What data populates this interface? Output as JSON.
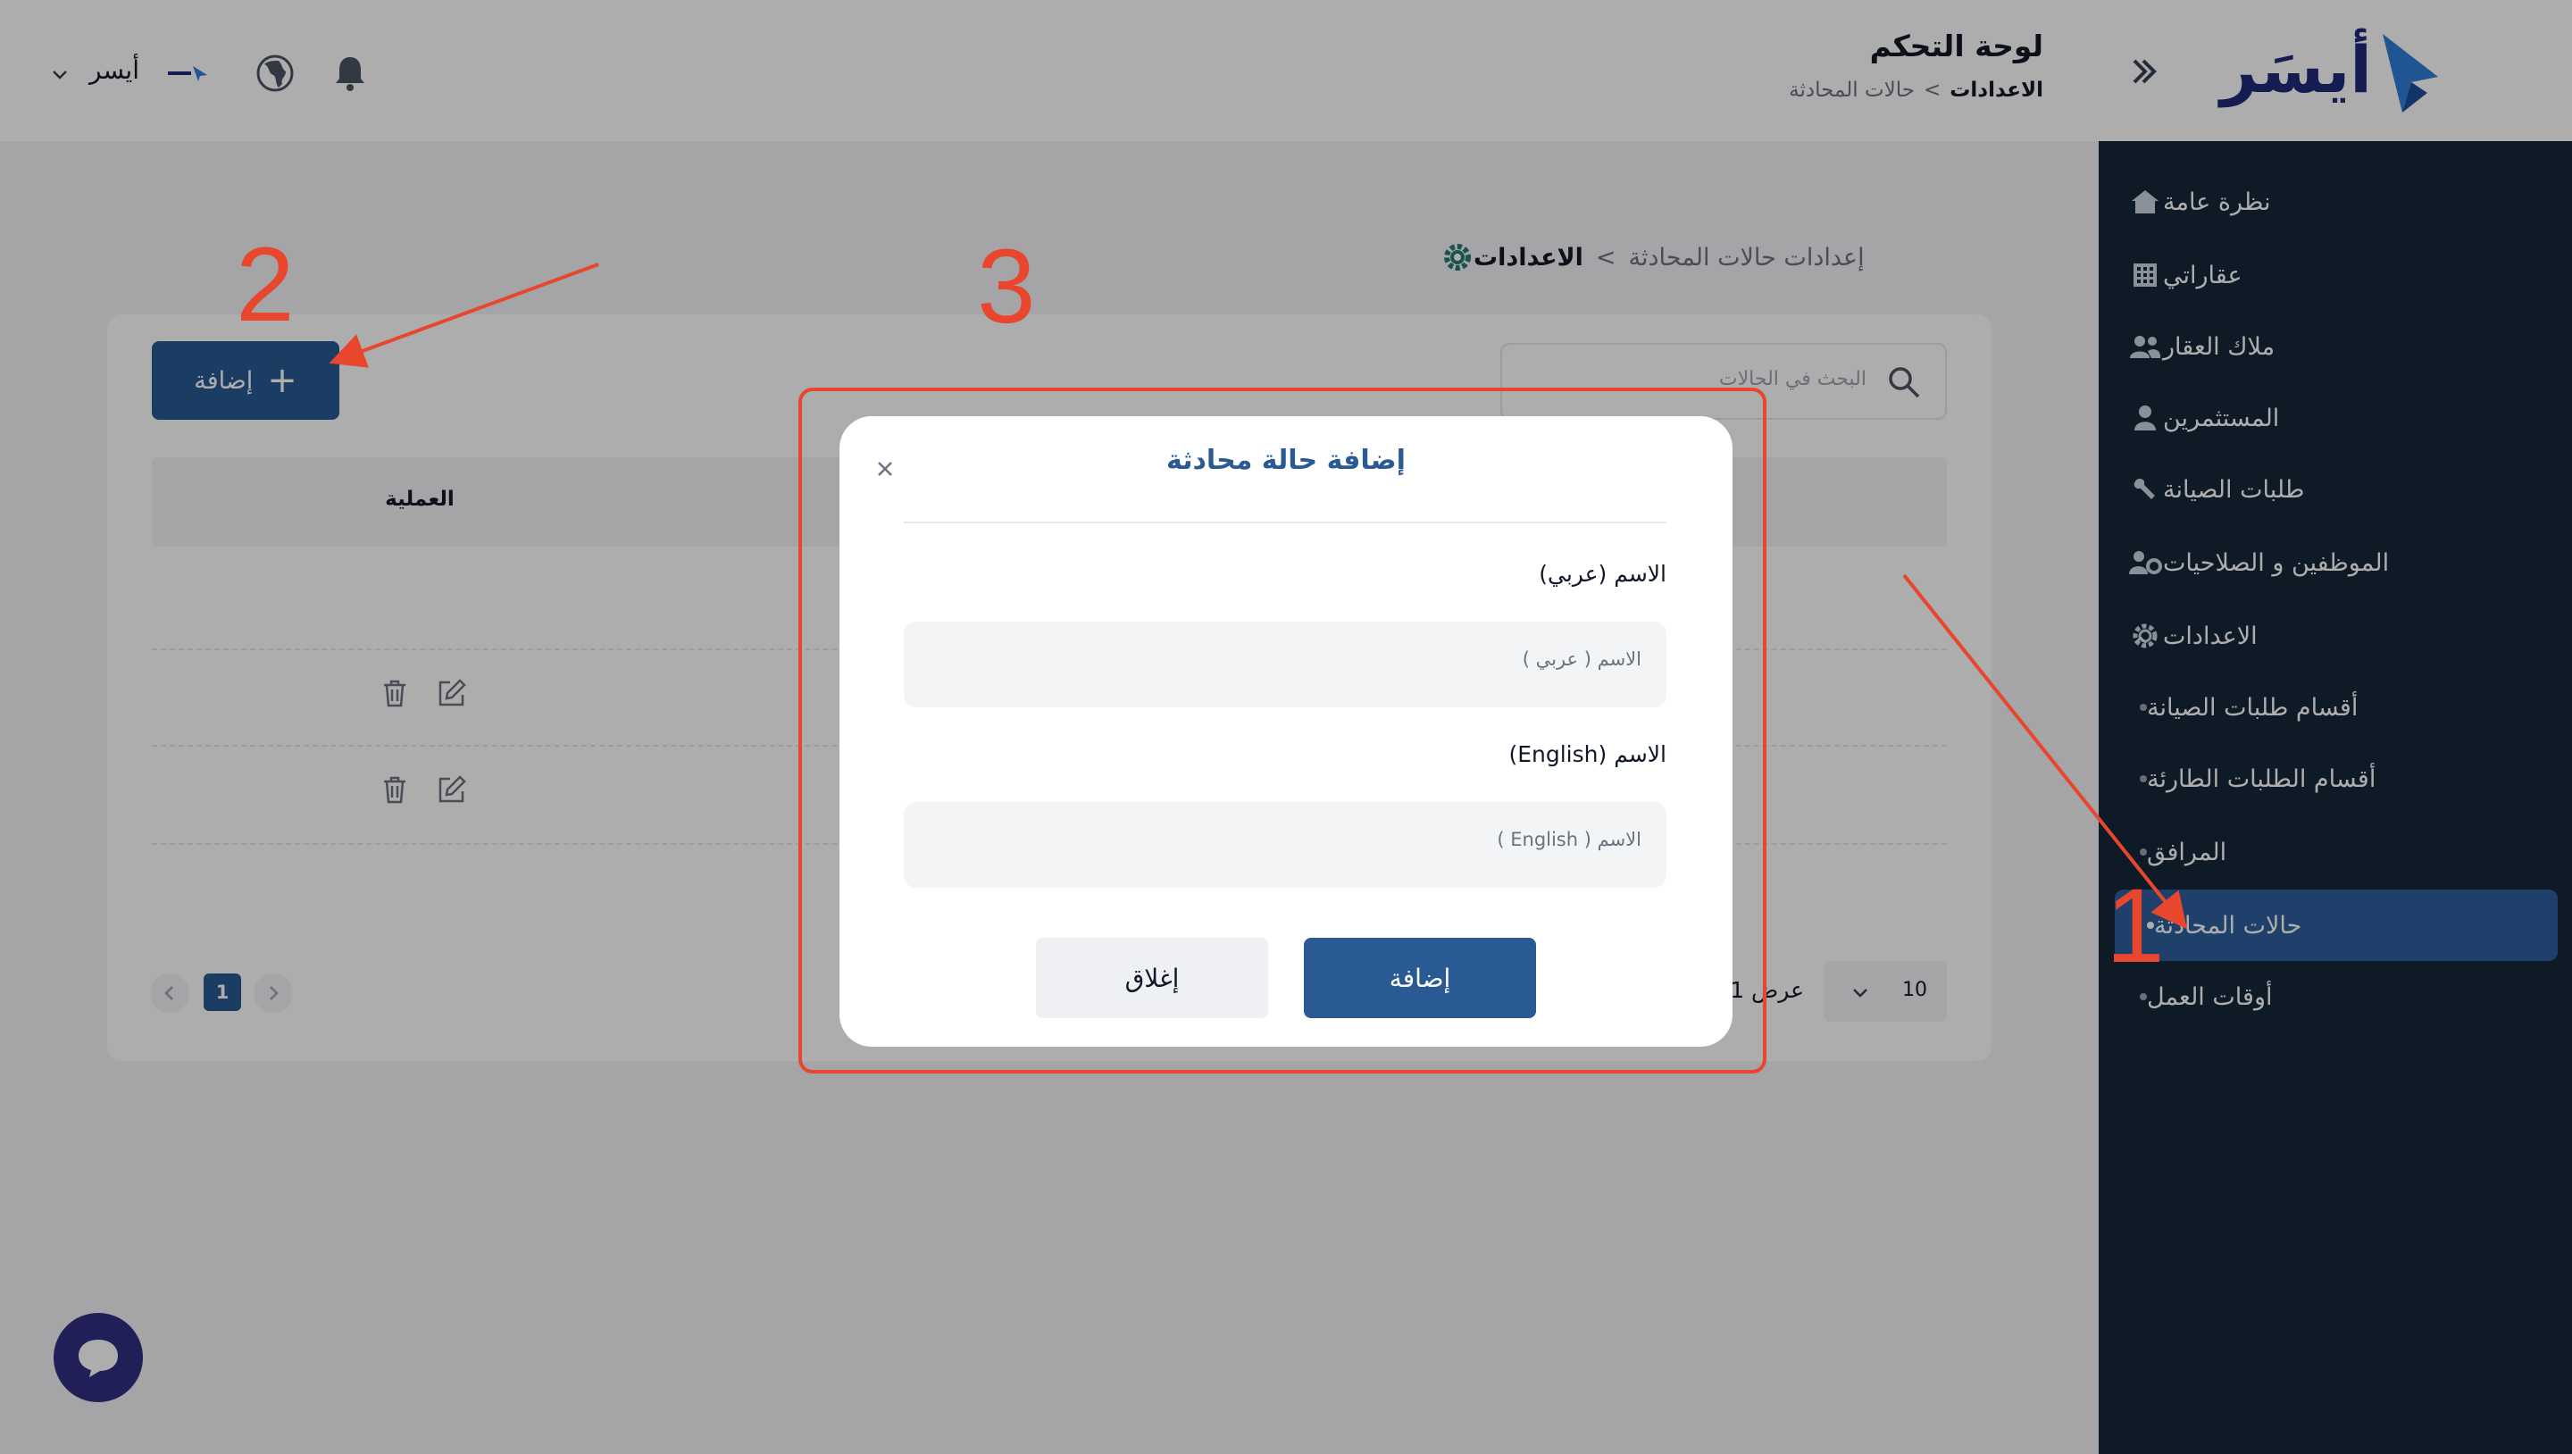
{
  "brand": {
    "name": "أيسَر"
  },
  "header": {
    "title": "لوحة التحكم",
    "breadcrumb": {
      "current": "الاعدادات",
      "separator": ">",
      "last": "حالات المحادثة"
    },
    "user_name": "أيسر"
  },
  "sidebar": {
    "items": [
      {
        "label": "نظرة عامة",
        "icon": "home-icon"
      },
      {
        "label": "عقاراتي",
        "icon": "building-icon"
      },
      {
        "label": "ملاك العقار",
        "icon": "users-icon"
      },
      {
        "label": "المستثمرين",
        "icon": "user-icon"
      },
      {
        "label": "طلبات الصيانة",
        "icon": "wrench-icon"
      },
      {
        "label": "الموظفين و الصلاحيات",
        "icon": "users-cog-icon"
      },
      {
        "label": "الاعدادات",
        "icon": "gear-icon"
      }
    ],
    "subitems": [
      {
        "label": "أقسام طلبات الصيانة"
      },
      {
        "label": "أقسام الطلبات الطارئة"
      },
      {
        "label": "المرافق"
      },
      {
        "label": "حالات المحادثة",
        "active": true
      },
      {
        "label": "أوقات العمل"
      }
    ]
  },
  "page": {
    "breadcrumb": {
      "current": "الاعدادات",
      "separator": ">",
      "last": "إعدادات حالات المحادثة"
    },
    "add_button": "إضافة",
    "search_placeholder": "البحث في الحالات",
    "table": {
      "col_operation": "العملية"
    },
    "pagination": {
      "current_page": "1",
      "page_size": "10",
      "show_label": "عرض 1"
    }
  },
  "modal": {
    "title": "إضافة حالة محادثة",
    "field_ar": {
      "label": "الاسم (عربي)",
      "placeholder": "الاسم ( عربي )"
    },
    "field_en": {
      "label": "الاسم (English)",
      "placeholder": "الاسم ( English )"
    },
    "submit": "إضافة",
    "close": "إغلاق"
  },
  "annotations": {
    "n1": "1",
    "n2": "2",
    "n3": "3",
    "color": "#e8462d"
  },
  "colors": {
    "primary": "#2a5a93",
    "sidebar": "#16283a",
    "brand": "#1f2a7a"
  }
}
